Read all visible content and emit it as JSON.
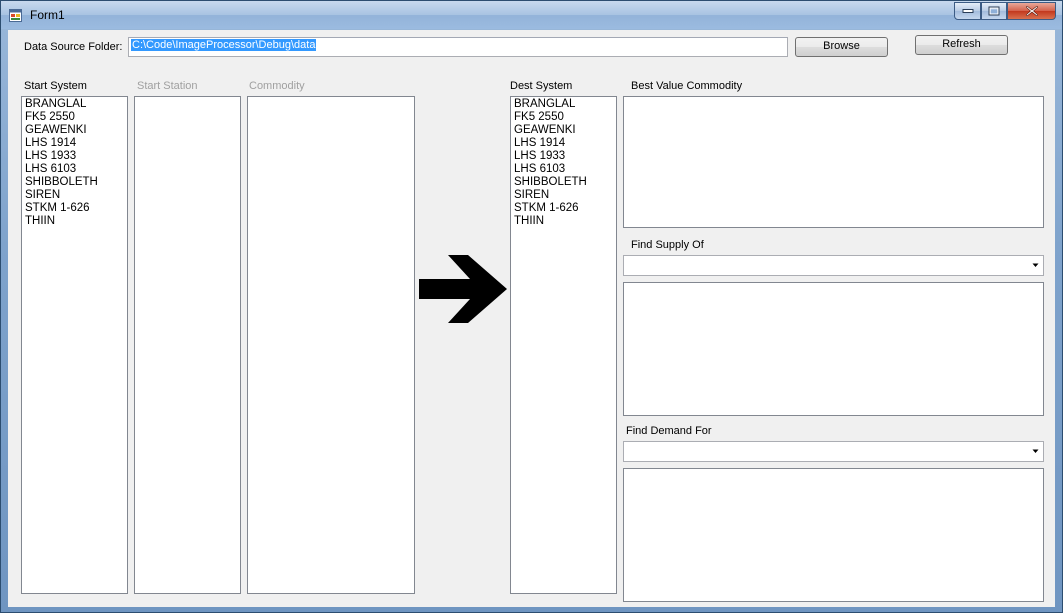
{
  "window": {
    "title": "Form1",
    "icon": "winforms-app-icon",
    "controls": [
      "minimize-icon",
      "maximize-icon",
      "close-icon"
    ]
  },
  "data_source": {
    "label": "Data Source Folder:",
    "value": "C:\\Code\\ImageProcessor\\Debug\\data",
    "browse_label": "Browse",
    "refresh_label": "Refresh"
  },
  "start_system": {
    "label": "Start System",
    "items": [
      "BRANGLAL",
      "FK5 2550",
      "GEAWENKI",
      "LHS 1914",
      "LHS 1933",
      "LHS 6103",
      "SHIBBOLETH",
      "SIREN",
      "STKM 1-626",
      "THIIN"
    ]
  },
  "start_station": {
    "label": "Start Station",
    "items": []
  },
  "commodity": {
    "label": "Commodity",
    "items": []
  },
  "direction_icon": "right-arrow-icon",
  "dest_system": {
    "label": "Dest System",
    "items": [
      "BRANGLAL",
      "FK5 2550",
      "GEAWENKI",
      "LHS 1914",
      "LHS 1933",
      "LHS 6103",
      "SHIBBOLETH",
      "SIREN",
      "STKM 1-626",
      "THIIN"
    ]
  },
  "best_value": {
    "label": "Best Value Commodity",
    "items": []
  },
  "find_supply": {
    "label": "Find Supply Of",
    "selected": "",
    "items": []
  },
  "find_demand": {
    "label": "Find Demand For",
    "selected": "",
    "items": []
  }
}
